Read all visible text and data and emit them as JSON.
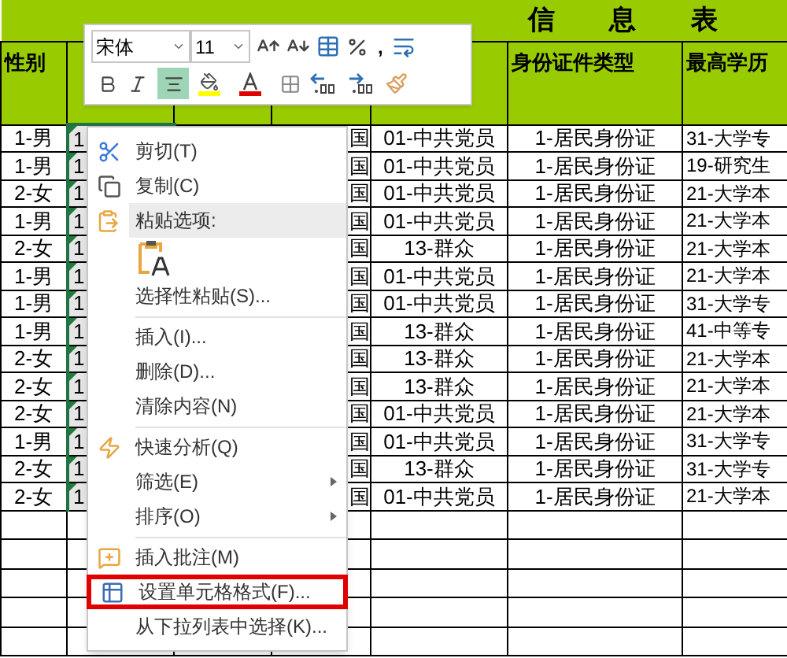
{
  "sheet": {
    "title": "信 息 表",
    "headers": [
      {
        "label": "性别"
      },
      {
        "label": "身份证件类型"
      },
      {
        "label": "最高学历"
      }
    ],
    "rows": [
      {
        "sex": "1-男",
        "col_b": "1",
        "nation": "国",
        "politics": "01-中共党员",
        "id_type": "1-居民身份证",
        "education": "31-大学专"
      },
      {
        "sex": "1-男",
        "col_b": "1",
        "nation": "国",
        "politics": "01-中共党员",
        "id_type": "1-居民身份证",
        "education": "19-研究生"
      },
      {
        "sex": "2-女",
        "col_b": "1",
        "nation": "国",
        "politics": "01-中共党员",
        "id_type": "1-居民身份证",
        "education": "21-大学本"
      },
      {
        "sex": "1-男",
        "col_b": "1",
        "nation": "国",
        "politics": "01-中共党员",
        "id_type": "1-居民身份证",
        "education": "21-大学本"
      },
      {
        "sex": "2-女",
        "col_b": "1",
        "nation": "国",
        "politics": "13-群众",
        "id_type": "1-居民身份证",
        "education": "21-大学本"
      },
      {
        "sex": "1-男",
        "col_b": "1",
        "nation": "国",
        "politics": "01-中共党员",
        "id_type": "1-居民身份证",
        "education": "21-大学本"
      },
      {
        "sex": "1-男",
        "col_b": "1",
        "nation": "国",
        "politics": "01-中共党员",
        "id_type": "1-居民身份证",
        "education": "31-大学专"
      },
      {
        "sex": "1-男",
        "col_b": "1",
        "nation": "国",
        "politics": "13-群众",
        "id_type": "1-居民身份证",
        "education": "41-中等专"
      },
      {
        "sex": "2-女",
        "col_b": "1",
        "nation": "国",
        "politics": "13-群众",
        "id_type": "1-居民身份证",
        "education": "21-大学本"
      },
      {
        "sex": "2-女",
        "col_b": "1",
        "nation": "国",
        "politics": "13-群众",
        "id_type": "1-居民身份证",
        "education": "21-大学本"
      },
      {
        "sex": "2-女",
        "col_b": "1",
        "nation": "国",
        "politics": "01-中共党员",
        "id_type": "1-居民身份证",
        "education": "21-大学本"
      },
      {
        "sex": "1-男",
        "col_b": "1",
        "nation": "国",
        "politics": "01-中共党员",
        "id_type": "1-居民身份证",
        "education": "31-大学专"
      },
      {
        "sex": "2-女",
        "col_b": "1",
        "nation": "国",
        "politics": "13-群众",
        "id_type": "1-居民身份证",
        "education": "31-大学专"
      },
      {
        "sex": "2-女",
        "col_b": "1",
        "nation": "国",
        "politics": "01-中共党员",
        "id_type": "1-居民身份证",
        "education": "21-大学本"
      }
    ]
  },
  "mini_toolbar": {
    "font": "宋体",
    "size": "11",
    "comma": ",",
    "align_center": {
      "selected": true
    }
  },
  "context_menu": [
    {
      "kind": "command",
      "label": "剪切(T)"
    },
    {
      "kind": "command",
      "label": "复制(C)"
    },
    {
      "kind": "header",
      "label": "粘贴选项:"
    },
    {
      "kind": "paste-option"
    },
    {
      "kind": "command",
      "label": "选择性粘贴(S)..."
    },
    {
      "kind": "separator"
    },
    {
      "kind": "command",
      "label": "插入(I)..."
    },
    {
      "kind": "command",
      "label": "删除(D)..."
    },
    {
      "kind": "command",
      "label": "清除内容(N)"
    },
    {
      "kind": "separator"
    },
    {
      "kind": "command",
      "label": "快速分析(Q)"
    },
    {
      "kind": "submenu",
      "label": "筛选(E)"
    },
    {
      "kind": "submenu",
      "label": "排序(O)"
    },
    {
      "kind": "separator"
    },
    {
      "kind": "command",
      "label": "插入批注(M)"
    },
    {
      "kind": "command",
      "label": "设置单元格格式(F)...",
      "highlighted": true
    },
    {
      "kind": "command",
      "label": "从下拉列表中选择(K)..."
    }
  ]
}
